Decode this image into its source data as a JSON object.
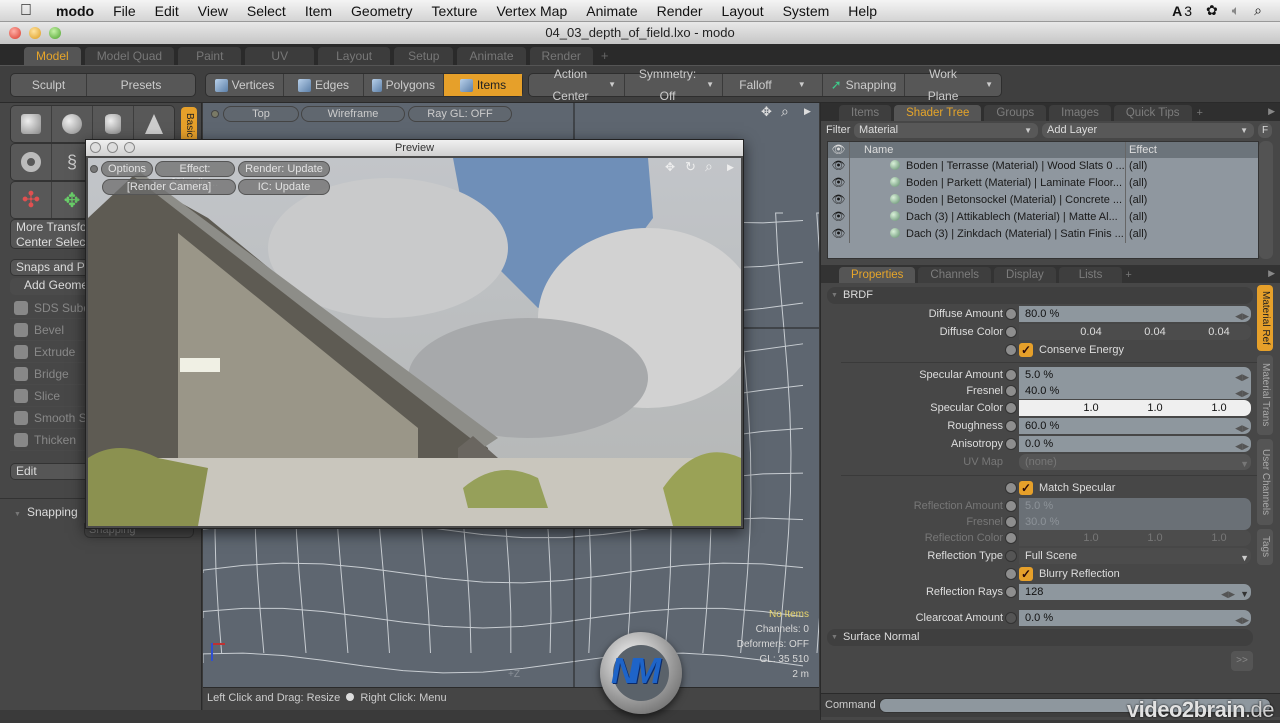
{
  "menubar": {
    "apple": "",
    "items": [
      "modo",
      "File",
      "Edit",
      "View",
      "Select",
      "Item",
      "Geometry",
      "Texture",
      "Vertex Map",
      "Animate",
      "Render",
      "Layout",
      "System",
      "Help"
    ],
    "status_adobe": "3",
    "status_icons": [
      "adobe-icon",
      "bluetooth-icon",
      "volume-icon",
      "spotlight-search-icon"
    ]
  },
  "window": {
    "title": "04_03_depth_of_field.lxo - modo"
  },
  "layout_tabs": {
    "items": [
      "Model",
      "Model Quad",
      "Paint",
      "UV",
      "Layout",
      "Setup",
      "Animate",
      "Render"
    ],
    "active": "Model",
    "add": "+"
  },
  "toolbar": {
    "sculpt": "Sculpt",
    "presets": "Presets",
    "vertices": "Vertices",
    "edges": "Edges",
    "polygons": "Polygons",
    "items": "Items",
    "action_center": "Action Center",
    "symmetry": "Symmetry: Off",
    "falloff": "Falloff",
    "snapping": "Snapping",
    "work_plane": "Work Plane",
    "active_mode": "Items"
  },
  "left_panel": {
    "basic_tab": "Basic",
    "more_transforms": "More Transforms",
    "center_selected": "Center Selected",
    "snaps_and_presets": "Snaps and Presets",
    "add_geometry": "Add Geometry",
    "tools": [
      "SDS Subdivide",
      "Bevel",
      "Extrude",
      "Bridge",
      "Slice",
      "Smooth Shift",
      "Thicken"
    ],
    "edit": "Edit",
    "snapping": "Snapping",
    "snapping_sub": "Snapping"
  },
  "viewport": {
    "view": "Top",
    "shading": "Wireframe",
    "raygl": "Ray GL: OFF",
    "status": {
      "no_items": "No Items",
      "channels": "Channels: 0",
      "deformers": "Deformers: OFF",
      "gl": "GL: 35 510",
      "scale": "2 m"
    },
    "axis_label": "+Z"
  },
  "statusbar": {
    "left": "Left Click and Drag: Resize",
    "right": "Right Click: Menu"
  },
  "preview": {
    "title": "Preview",
    "options": "Options",
    "effect": "Effect: [Shadin...",
    "render": "Render: Update",
    "camera": "[Render Camera]",
    "ic": "IC: Update"
  },
  "right_top_tabs": {
    "items": [
      "Items",
      "Shader Tree",
      "Groups",
      "Images",
      "Quick Tips"
    ],
    "active": "Shader Tree",
    "add": "+"
  },
  "shader_tree": {
    "filter_label": "Filter",
    "filter_value": "Material",
    "add_layer": "Add Layer",
    "f_button": "F",
    "columns": {
      "name": "Name",
      "effect": "Effect"
    },
    "rows": [
      {
        "name": "Boden | Terrasse (Material) | Wood Slats 0 ...",
        "effect": "(all)"
      },
      {
        "name": "Boden | Parkett (Material) | Laminate Floor...",
        "effect": "(all)"
      },
      {
        "name": "Boden | Betonsockel (Material) | Concrete ...",
        "effect": "(all)"
      },
      {
        "name": "Dach (3) | Attikablech (Material) | Matte Al...",
        "effect": "(all)"
      },
      {
        "name": "Dach (3) | Zinkdach (Material) | Satin Finis ...",
        "effect": "(all)"
      }
    ]
  },
  "props_tabs": {
    "items": [
      "Properties",
      "Channels",
      "Display",
      "Lists"
    ],
    "active": "Properties",
    "add": "+"
  },
  "properties": {
    "brdf": "BRDF",
    "diffuse_amount": {
      "label": "Diffuse Amount",
      "value": "80.0 %"
    },
    "diffuse_color": {
      "label": "Diffuse Color",
      "r": "0.04",
      "g": "0.04",
      "b": "0.04"
    },
    "conserve_energy": {
      "label": "Conserve Energy",
      "checked": true
    },
    "specular_amount": {
      "label": "Specular Amount",
      "value": "5.0 %"
    },
    "fresnel": {
      "label": "Fresnel",
      "value": "40.0 %"
    },
    "specular_color": {
      "label": "Specular Color",
      "r": "1.0",
      "g": "1.0",
      "b": "1.0"
    },
    "roughness": {
      "label": "Roughness",
      "value": "60.0 %"
    },
    "anisotropy": {
      "label": "Anisotropy",
      "value": "0.0 %"
    },
    "uv_map": {
      "label": "UV Map",
      "value": "(none)"
    },
    "match_specular": {
      "label": "Match Specular",
      "checked": true
    },
    "reflection_amount": {
      "label": "Reflection Amount",
      "value": "5.0 %"
    },
    "reflection_fresnel": {
      "label": "Fresnel",
      "value": "30.0 %"
    },
    "reflection_color": {
      "label": "Reflection Color",
      "r": "1.0",
      "g": "1.0",
      "b": "1.0"
    },
    "reflection_type": {
      "label": "Reflection Type",
      "value": "Full Scene"
    },
    "blurry_reflection": {
      "label": "Blurry Reflection",
      "checked": true
    },
    "reflection_rays": {
      "label": "Reflection Rays",
      "value": "128"
    },
    "clearcoat_amount": {
      "label": "Clearcoat Amount",
      "value": "0.0 %"
    },
    "surface_normal": "Surface Normal",
    "more_button": ">>"
  },
  "side_tabs": [
    "Material Ref",
    "Material Trans",
    "User Channels",
    "Tags"
  ],
  "command": {
    "label": "Command",
    "value": ""
  },
  "watermark": {
    "brand": "video2brain",
    "tld": ".de"
  },
  "colors": {
    "accent": "#e6a02a",
    "viewport_bg": "#5e6670",
    "panel_bg": "#474747"
  }
}
